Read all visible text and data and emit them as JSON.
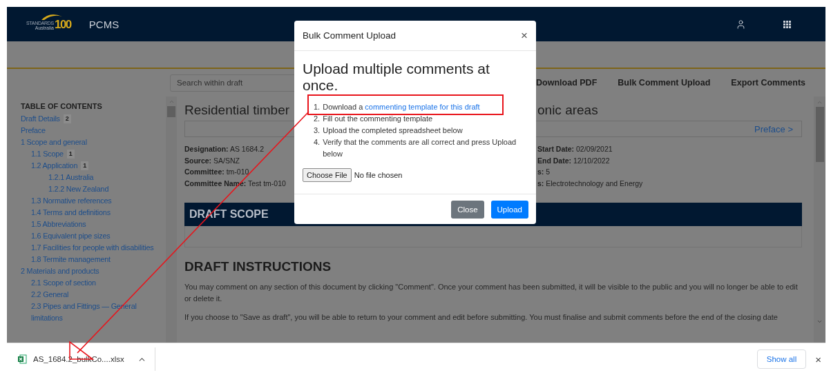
{
  "header": {
    "logo": {
      "wordmark": "STANDARDS",
      "subtitle": "Australia",
      "mark": "100"
    },
    "app_name": "PCMS"
  },
  "toolbar": {
    "search": {
      "placeholder": "Search within draft"
    },
    "actions": [
      "Download PDF",
      "Bulk Comment Upload",
      "Export Comments"
    ]
  },
  "toc": {
    "heading": "TABLE OF CONTENTS",
    "items": [
      {
        "label": "Draft Details",
        "count": "2"
      },
      {
        "label": "Preface"
      },
      {
        "label": "1 Scope and general",
        "children": [
          {
            "label": "1.1 Scope",
            "count": "1"
          },
          {
            "label": "1.2 Application",
            "count": "1",
            "children": [
              {
                "label": "1.2.1 Australia"
              },
              {
                "label": "1.2.2 New Zealand"
              }
            ]
          },
          {
            "label": "1.3 Normative references"
          },
          {
            "label": "1.4 Terms and definitions"
          },
          {
            "label": "1.5 Abbreviations"
          },
          {
            "label": "1.6 Equivalent pipe sizes"
          },
          {
            "label": "1.7 Facilities for people with disabilities"
          },
          {
            "label": "1.8 Termite management"
          }
        ]
      },
      {
        "label": "2 Materials and products",
        "children": [
          {
            "label": "2.1 Scope of section"
          },
          {
            "label": "2.2 General"
          },
          {
            "label": "2.3 Pipes and Fittings — General limitations"
          }
        ]
      }
    ]
  },
  "document": {
    "title_parts": [
      "Residential timber",
      "onic areas"
    ],
    "preface_link": "Preface >",
    "details_left": [
      {
        "label": "Designation:",
        "value": "AS 1684.2"
      },
      {
        "label": "Source:",
        "value": "SA/SNZ"
      },
      {
        "label": "Committee:",
        "value": "tm-010"
      },
      {
        "label": "Committee Name:",
        "value": "Test tm-010"
      }
    ],
    "details_right": [
      {
        "label": "Start Date:",
        "value": "02/09/2021"
      },
      {
        "label": "End Date:",
        "value": "12/10/2022"
      },
      {
        "label": "s:",
        "value": "5"
      },
      {
        "label": "s:",
        "value": "Electrotechnology and Energy"
      }
    ],
    "scope_heading": "DRAFT SCOPE",
    "instructions_heading": "DRAFT INSTRUCTIONS",
    "paragraphs": [
      "You may comment on any section of this document by clicking \"Comment\". Once your comment has been submitted, it will be visible to the public and you will no longer be able to edit or delete it.",
      "If you choose to \"Save as draft\", you will be able to return to your comment and edit before submitting. You must finalise and submit comments before the end of the closing date"
    ]
  },
  "modal": {
    "title": "Bulk Comment Upload",
    "close": "×",
    "heading": "Upload multiple comments at once.",
    "steps": [
      {
        "number": "1.",
        "text": "Download a ",
        "link": "commenting template for this draft"
      },
      {
        "number": "2.",
        "text": "Fill out the commenting template"
      },
      {
        "number": "3.",
        "text": "Upload the completed spreadsheet below"
      },
      {
        "number": "4.",
        "text": "Verify that the comments are all correct and press Upload below"
      }
    ],
    "file_button": "Choose File",
    "file_status": "No file chosen",
    "buttons": [
      {
        "label": "Close",
        "kind": "secondary"
      },
      {
        "label": "Upload",
        "kind": "primary"
      }
    ]
  },
  "download_bar": {
    "file_name": "AS_1684.2_bulkCo....xlsx",
    "show_all": "Show all",
    "close": "×"
  }
}
